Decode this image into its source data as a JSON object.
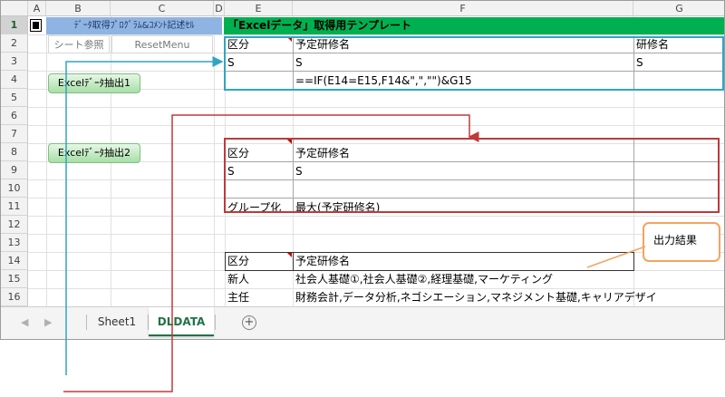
{
  "columns": [
    "A",
    "B",
    "C",
    "D",
    "E",
    "F",
    "G"
  ],
  "rows": [
    "1",
    "2",
    "3",
    "4",
    "5",
    "6",
    "7",
    "8",
    "9",
    "10",
    "11",
    "12",
    "13",
    "14",
    "15",
    "16"
  ],
  "row1": {
    "b_banner": "ﾃﾞｰﾀ取得ﾌﾟﾛｸﾞﾗﾑ&ｺﾒﾝﾄ記述ｾﾙ",
    "e_banner": "「Excelデータ」取得用テンプレート"
  },
  "row2": {
    "sheet_ref_button": "シート参照",
    "reset_menu_button": "ResetMenu",
    "e": "区分",
    "f": "予定研修名",
    "g": "研修名"
  },
  "row3": {
    "e": "S",
    "f": "S",
    "g": "S"
  },
  "row4": {
    "f": "==IF(E14=E15,F14&\",\",\"\")&G15"
  },
  "buttons": {
    "extract1": "Excelﾃﾞｰﾀ抽出1",
    "extract2": "Excelﾃﾞｰﾀ抽出2"
  },
  "row8": {
    "e": "区分",
    "f": "予定研修名"
  },
  "row9": {
    "e": "S",
    "f": "S"
  },
  "row11": {
    "e": "グループ化",
    "f": "最大(予定研修名)"
  },
  "row14": {
    "e": "区分",
    "f": "予定研修名"
  },
  "row15": {
    "e": "新人",
    "f": "社会人基礎①,社会人基礎②,経理基礎,マーケティング"
  },
  "row16": {
    "e": "主任",
    "f": "財務会計,データ分析,ネゴシエーション,マネジメント基礎,キャリアデザイン"
  },
  "callout": "出力結果",
  "sheet_tabs": {
    "sheet1": "Sheet1",
    "dldata": "DLDATA",
    "active": "DLDATA"
  },
  "colors": {
    "blue_banner": "#8eb4e3",
    "green_banner": "#00b050",
    "blue_box": "#31a4c4",
    "red_box": "#c0393b",
    "callout_border": "#f4a460",
    "active_tab": "#217346"
  },
  "icons": {
    "nav_left": "triangle-left",
    "nav_right": "triangle-right",
    "add_sheet": "plus-circle"
  }
}
